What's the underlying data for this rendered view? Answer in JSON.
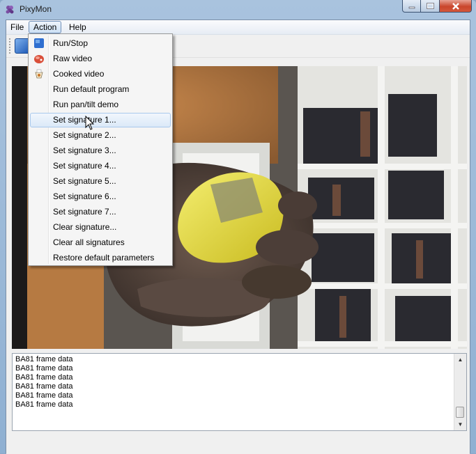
{
  "window": {
    "title": "PixyMon",
    "icon": "pixy-grapes-icon"
  },
  "menubar": {
    "file": "File",
    "action": "Action",
    "help": "Help"
  },
  "action_menu": {
    "items": [
      {
        "label": "Run/Stop",
        "icon": "run-stop-icon"
      },
      {
        "label": "Raw video",
        "icon": "raw-video-icon"
      },
      {
        "label": "Cooked video",
        "icon": "cooked-video-icon"
      },
      {
        "label": "Run default program"
      },
      {
        "label": "Run pan/tilt demo"
      },
      {
        "label": "Set signature 1...",
        "highlighted": true
      },
      {
        "label": "Set signature 2..."
      },
      {
        "label": "Set signature 3..."
      },
      {
        "label": "Set signature 4..."
      },
      {
        "label": "Set signature 5..."
      },
      {
        "label": "Set signature 6..."
      },
      {
        "label": "Set signature 7..."
      },
      {
        "label": "Clear signature..."
      },
      {
        "label": "Clear all signatures"
      },
      {
        "label": "Restore default parameters"
      }
    ]
  },
  "log": {
    "lines": [
      "BA81 frame data",
      "BA81 frame data",
      "BA81 frame data",
      "BA81 frame data",
      "BA81 frame data",
      "BA81 frame data"
    ]
  },
  "colors": {
    "highlight": "#dbe9f8",
    "close_button": "#c9462c",
    "object_yellow": "#e6dd3c"
  }
}
